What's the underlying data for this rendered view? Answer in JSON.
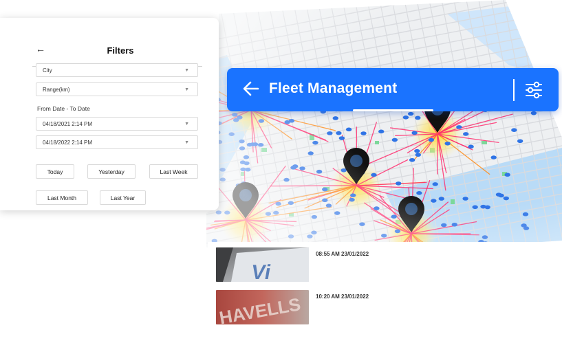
{
  "filters": {
    "back_icon": "arrow-left-icon",
    "title": "Filters",
    "city": "City",
    "range": "Range(km)",
    "date_range_label": "From Date - To Date",
    "from_date": "04/18/2021 2:14 PM",
    "to_date": "04/18/2022 2:14 PM",
    "caret": "▼",
    "quick_ranges": [
      "Today",
      "Yesterday",
      "Last Week",
      "Last Month",
      "Last Year"
    ]
  },
  "header": {
    "title": "Fleet Management",
    "back_icon": "arrow-left-icon",
    "settings_icon": "sliders-icon",
    "accent": "#1a73ff"
  },
  "feed": {
    "entries": [
      {
        "time": "08:55 AM 23/01/2022",
        "image_text": "Vi"
      },
      {
        "time": "10:20 AM 23/01/2022",
        "image_text": "HAVELLS"
      }
    ]
  },
  "map": {
    "water": "#b9dbf7",
    "land": "#eef0f2",
    "road": "#d9dbdf",
    "route_red": "#ff2d6e",
    "route_orange": "#ff8a14",
    "hub_glow": "#ffdc3a",
    "vehicle": "#2f74e6",
    "pin": "#111111",
    "park": "#7cd89a"
  }
}
